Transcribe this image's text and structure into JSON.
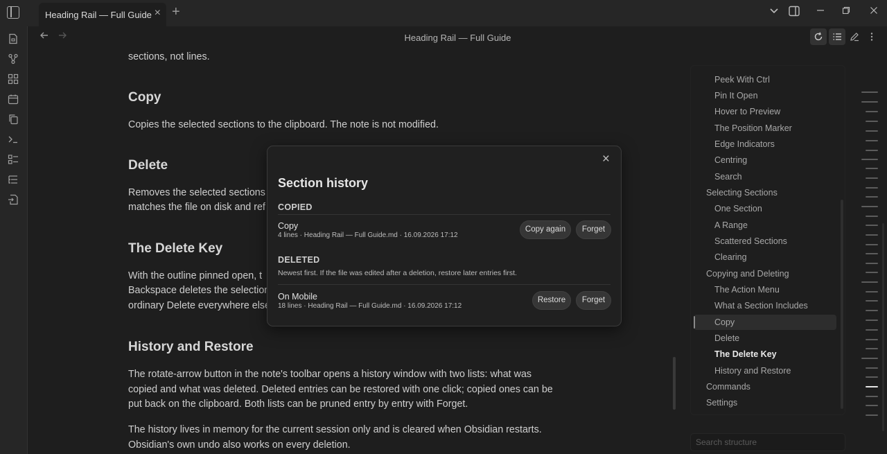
{
  "tab": {
    "title": "Heading Rail — Full Guide"
  },
  "header": {
    "title": "Heading Rail — Full Guide"
  },
  "editor": {
    "intro_tail": "sections, not lines.",
    "copy_heading": "Copy",
    "copy_text": "Copies the selected sections to the clipboard. The note is not modified.",
    "delete_heading": "Delete",
    "delete_text_1": "Removes the selected sections",
    "delete_text_2": "matches the file on disk and ref",
    "delete_key_heading": "The Delete Key",
    "delete_key_text_1": "With the outline pinned open, t",
    "delete_key_text_2": "Backspace deletes the selection",
    "delete_key_text_3": "ordinary Delete everywhere else",
    "history_heading": "History and Restore",
    "history_text_1": "The rotate-arrow button in the note's toolbar opens a history window with two lists: what was",
    "history_text_2": "copied and what was deleted. Deleted entries can be restored with one click; copied ones can be",
    "history_text_3": "put back on the clipboard. Both lists can be pruned entry by entry with Forget.",
    "history_text_4": "The history lives in memory for the current session only and is cleared when Obsidian restarts.",
    "history_text_5": "Obsidian's own undo also works on every deletion."
  },
  "modal": {
    "title": "Section history",
    "copied_heading": "COPIED",
    "copied_entries": [
      {
        "name": "Copy",
        "meta": "4 lines · Heading Rail — Full Guide.md · 16.09.2026 17:12",
        "primary_label": "Copy again",
        "forget_label": "Forget"
      }
    ],
    "deleted_heading": "DELETED",
    "deleted_note": "Newest first. If the file was edited after a deletion, restore later entries first.",
    "deleted_entries": [
      {
        "name": "On Mobile",
        "meta": "18 lines · Heading Rail — Full Guide.md · 16.09.2026 17:12",
        "primary_label": "Restore",
        "forget_label": "Forget"
      }
    ]
  },
  "outline": {
    "items": [
      {
        "label": "Peek With Ctrl",
        "level": 2
      },
      {
        "label": "Pin It Open",
        "level": 2
      },
      {
        "label": "Hover to Preview",
        "level": 2
      },
      {
        "label": "The Position Marker",
        "level": 2
      },
      {
        "label": "Edge Indicators",
        "level": 2
      },
      {
        "label": "Centring",
        "level": 2
      },
      {
        "label": "Search",
        "level": 2
      },
      {
        "label": "Selecting Sections",
        "level": 1
      },
      {
        "label": "One Section",
        "level": 2
      },
      {
        "label": "A Range",
        "level": 2
      },
      {
        "label": "Scattered Sections",
        "level": 2
      },
      {
        "label": "Clearing",
        "level": 2
      },
      {
        "label": "Copying and Deleting",
        "level": 1
      },
      {
        "label": "The Action Menu",
        "level": 2
      },
      {
        "label": "What a Section Includes",
        "level": 2
      },
      {
        "label": "Copy",
        "level": 2,
        "selected": true
      },
      {
        "label": "Delete",
        "level": 2
      },
      {
        "label": "The Delete Key",
        "level": 2,
        "current": true
      },
      {
        "label": "History and Restore",
        "level": 2
      },
      {
        "label": "Commands",
        "level": 1
      },
      {
        "label": "Settings",
        "level": 1
      }
    ],
    "search_placeholder": "Search structure"
  },
  "icons": {
    "ribbon": [
      "file-icon",
      "graph-icon",
      "grid-icon",
      "calendar-icon",
      "copy-icon",
      "terminal-icon",
      "checklist-icon",
      "list-tree-icon",
      "file-import-icon"
    ],
    "header": [
      "history-rotate-icon",
      "outline-list-icon",
      "edit-pencil-icon",
      "more-vertical-icon"
    ]
  }
}
